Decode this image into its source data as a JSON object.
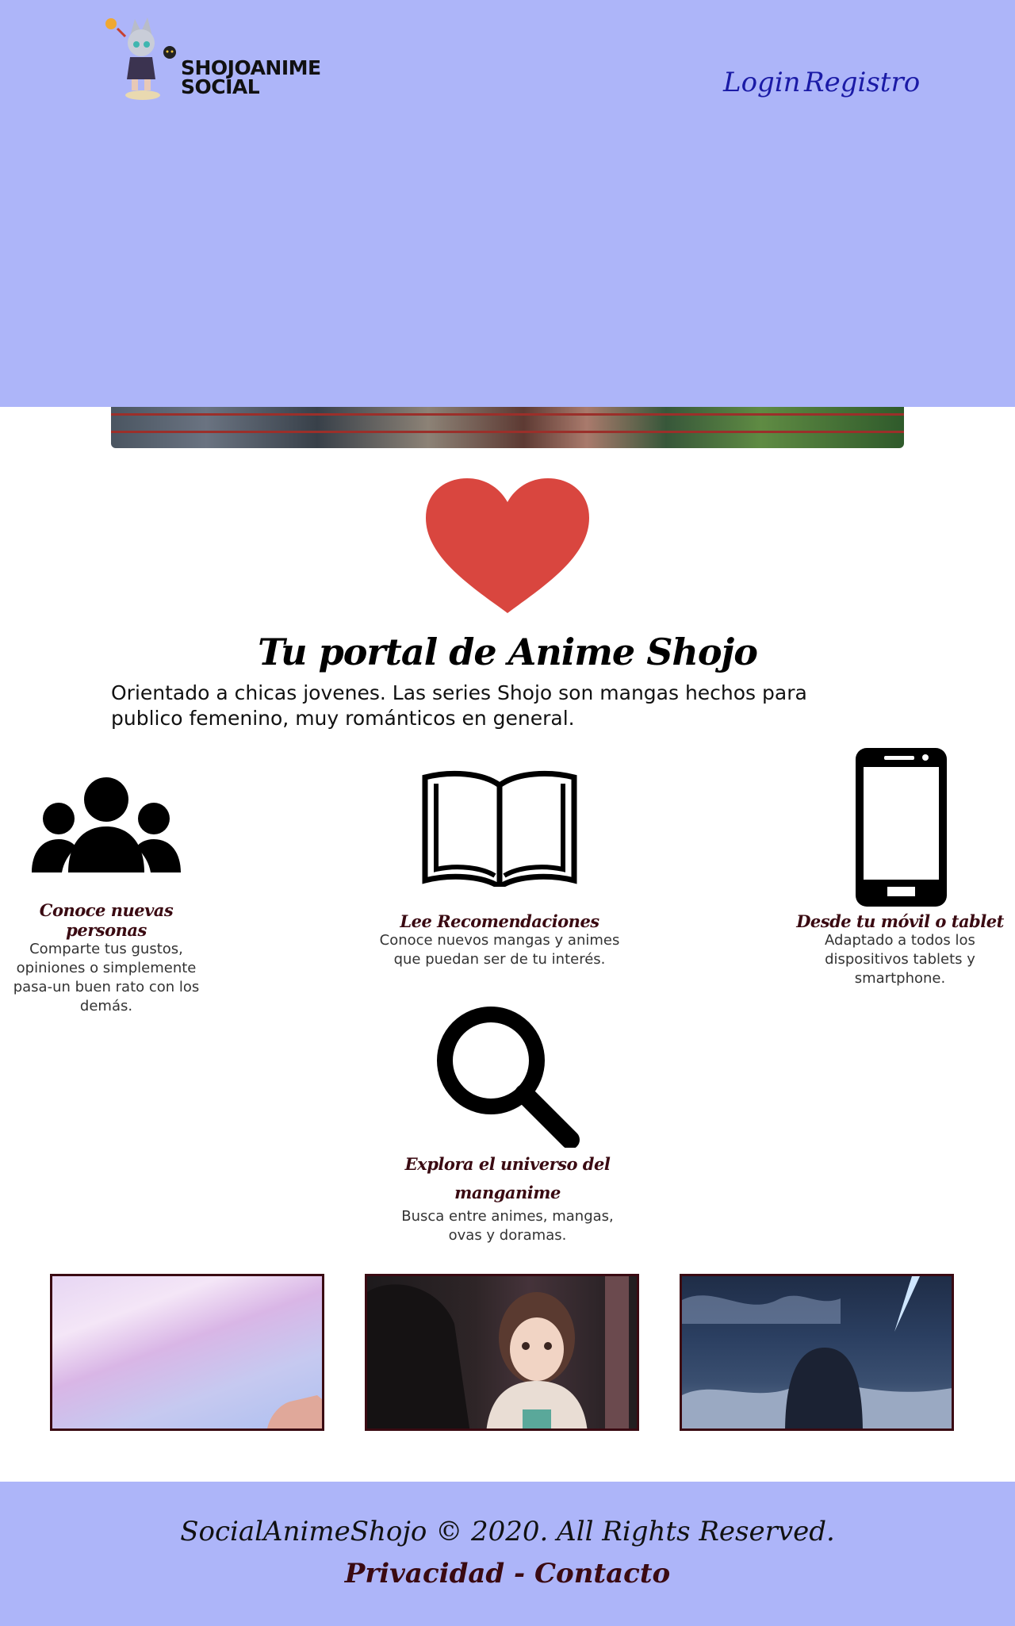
{
  "header": {
    "logo_text_line1": "SHOJOANIME",
    "logo_text_line2": "SOCIAL",
    "nav": {
      "login": "Login",
      "registro": "Registro"
    },
    "background": "#adb5f9"
  },
  "main": {
    "title": "Tu portal de Anime Shojo",
    "intro": "Orientado a chicas jovenes. Las series Shojo son mangas hechos para publico femenino, muy románticos en general.",
    "features": [
      {
        "icon": "users-icon",
        "title": "Conoce nuevas personas",
        "desc": "Comparte tus gustos, opiniones o simplemente pasa-un buen rato con los demás."
      },
      {
        "icon": "book-icon",
        "title": "Lee Recomendaciones",
        "desc": "Conoce nuevos mangas y animes que puedan ser de tu interés."
      },
      {
        "icon": "mobile-icon",
        "title": "Desde tu móvil o tablet",
        "desc": "Adaptado a todos los dispositivos tablets y smartphone."
      },
      {
        "icon": "search-icon",
        "title": "Explora el universo del manganime",
        "desc": "Busca entre animes, mangas, ovas y doramas."
      }
    ]
  },
  "footer": {
    "copyright": "SocialAnimeShojo © 2020. All Rights Reserved.",
    "privacy": "Privacidad",
    "separator": " - ",
    "contact": "Contacto"
  },
  "colors": {
    "accent": "#adb5f9",
    "heart": "#d9463f",
    "dark_red": "#3a0a12",
    "nav_blue": "#1a1aa6"
  }
}
